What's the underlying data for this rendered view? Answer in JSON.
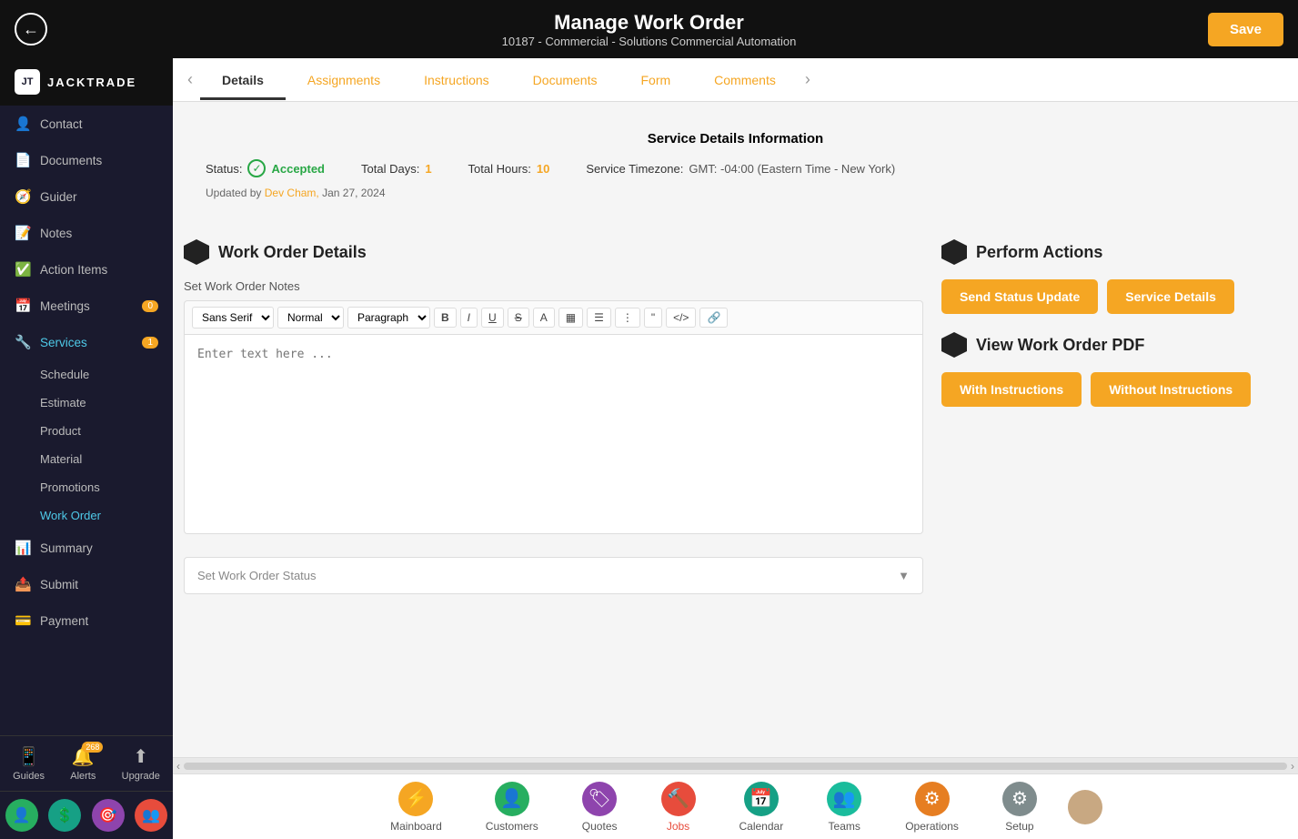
{
  "header": {
    "title": "Manage Work Order",
    "subtitle": "10187 - Commercial - Solutions Commercial Automation",
    "save_label": "Save"
  },
  "sidebar": {
    "logo_text": "JACKTRADE",
    "items": [
      {
        "label": "Contact",
        "icon": "👤",
        "active": false
      },
      {
        "label": "Documents",
        "icon": "📄",
        "active": false
      },
      {
        "label": "Guider",
        "icon": "🧭",
        "active": false
      },
      {
        "label": "Notes",
        "icon": "📝",
        "active": false
      },
      {
        "label": "Action Items",
        "icon": "✅",
        "active": false
      },
      {
        "label": "Meetings",
        "icon": "📅",
        "badge": "0",
        "active": false
      },
      {
        "label": "Services",
        "icon": "🔧",
        "badge": "1",
        "active": true
      },
      {
        "label": "Summary",
        "icon": "📊",
        "active": false
      },
      {
        "label": "Submit",
        "icon": "📤",
        "active": false
      },
      {
        "label": "Payment",
        "icon": "💳",
        "active": false
      }
    ],
    "sub_items": [
      {
        "label": "Schedule",
        "active": false
      },
      {
        "label": "Estimate",
        "active": false
      },
      {
        "label": "Product",
        "active": false
      },
      {
        "label": "Material",
        "active": false
      },
      {
        "label": "Promotions",
        "active": false
      },
      {
        "label": "Work Order",
        "active": true
      }
    ],
    "bottom_items": [
      {
        "label": "Guides",
        "icon": "📱"
      },
      {
        "label": "Alerts",
        "icon": "🔔",
        "badge": "268"
      },
      {
        "label": "Upgrade",
        "icon": "⬆"
      }
    ],
    "bottom_icons": [
      "👤",
      "💲",
      "🎯",
      "👥"
    ]
  },
  "tabs": [
    {
      "label": "Details",
      "active": true
    },
    {
      "label": "Assignments",
      "active": false
    },
    {
      "label": "Instructions",
      "active": false
    },
    {
      "label": "Documents",
      "active": false
    },
    {
      "label": "Form",
      "active": false
    },
    {
      "label": "Comments",
      "active": false
    }
  ],
  "service_info": {
    "title": "Service Details Information",
    "status_label": "Status:",
    "status_value": "Accepted",
    "total_days_label": "Total Days:",
    "total_days_value": "1",
    "total_hours_label": "Total Hours:",
    "total_hours_value": "10",
    "timezone_label": "Service Timezone:",
    "timezone_value": "GMT: -04:00 (Eastern Time - New York)",
    "updated_by": "Updated by",
    "author": "Dev Cham,",
    "date": "Jan 27, 2024"
  },
  "work_order": {
    "section_title": "Work Order Details",
    "notes_label": "Set Work Order Notes",
    "editor_placeholder": "Enter text here ...",
    "font_select": "Sans Serif",
    "size_select": "Normal",
    "format_select": "Paragraph",
    "status_label": "Set Work Order Status"
  },
  "perform_actions": {
    "section_title": "Perform Actions",
    "send_status_btn": "Send Status Update",
    "service_details_btn": "Service Details"
  },
  "view_pdf": {
    "section_title": "View Work Order PDF",
    "with_instructions_btn": "With Instructions",
    "without_instructions_btn": "Without Instructions"
  },
  "bottom_nav": [
    {
      "label": "Mainboard",
      "color": "yellow",
      "icon": "⚡"
    },
    {
      "label": "Customers",
      "color": "green",
      "icon": "👤"
    },
    {
      "label": "Quotes",
      "color": "purple",
      "icon": "🏷"
    },
    {
      "label": "Jobs",
      "color": "red",
      "icon": "🔨",
      "active": true
    },
    {
      "label": "Calendar",
      "color": "teal",
      "icon": "📅"
    },
    {
      "label": "Teams",
      "color": "blue-green",
      "icon": "👥"
    },
    {
      "label": "Operations",
      "color": "orange-red",
      "icon": "⚙"
    },
    {
      "label": "Setup",
      "color": "gray",
      "icon": "⚙"
    }
  ]
}
